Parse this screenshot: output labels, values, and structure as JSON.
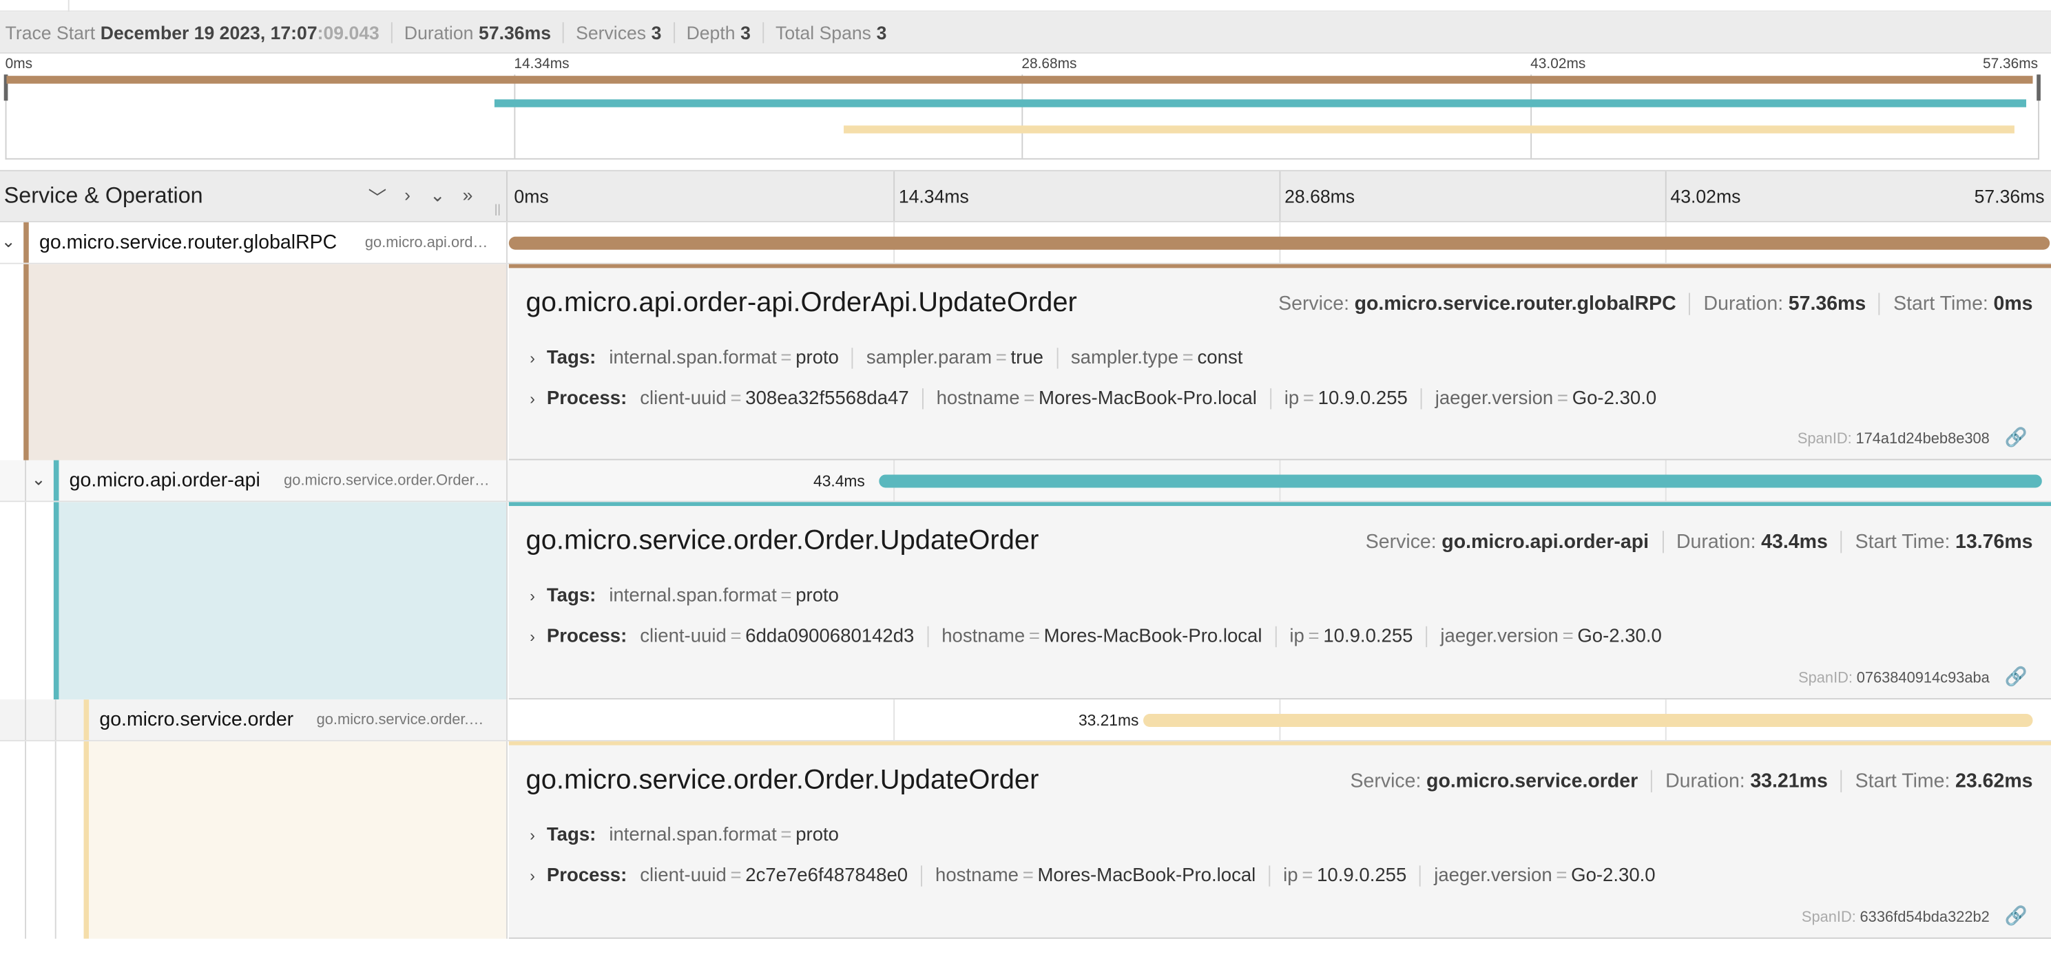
{
  "summary": {
    "trace_start_label": "Trace Start",
    "trace_start_value": "December 19 2023, 17:07",
    "trace_start_ms": ":09.043",
    "duration_label": "Duration",
    "duration_value": "57.36ms",
    "services_label": "Services",
    "services_value": "3",
    "depth_label": "Depth",
    "depth_value": "3",
    "total_spans_label": "Total Spans",
    "total_spans_value": "3"
  },
  "ticks": [
    "0ms",
    "14.34ms",
    "28.68ms",
    "43.02ms",
    "57.36ms"
  ],
  "header": {
    "title": "Service & Operation",
    "controls": [
      "chevron-down-icon",
      "chevron-right-icon",
      "double-chevron-down-icon",
      "double-chevron-right-icon"
    ]
  },
  "colors": {
    "router": "#b58a63",
    "order_api": "#5ab8be",
    "order": "#f5deaa",
    "router_bg": "#f0e8e1",
    "order_api_bg": "#dcedf0",
    "order_bg": "#fbf6ec"
  },
  "spans": [
    {
      "service": "go.micro.service.router.globalRPC",
      "operation": "go.micro.api.order-api.OrderApi.UpdateOrder",
      "operation_short": "go.micro.api.ord…",
      "bar_label": "",
      "start_ms": 0,
      "duration_ms": 57.36,
      "detail": {
        "title": "go.micro.api.order-api.OrderApi.UpdateOrder",
        "service_label": "Service:",
        "service_value": "go.micro.service.router.globalRPC",
        "duration_label": "Duration:",
        "duration_value": "57.36ms",
        "start_label": "Start Time:",
        "start_value": "0ms",
        "tags_label": "Tags:",
        "tags": [
          {
            "k": "internal.span.format",
            "v": "proto"
          },
          {
            "k": "sampler.param",
            "v": "true"
          },
          {
            "k": "sampler.type",
            "v": "const"
          }
        ],
        "process_label": "Process:",
        "process": [
          {
            "k": "client-uuid",
            "v": "308ea32f5568da47"
          },
          {
            "k": "hostname",
            "v": "Mores-MacBook-Pro.local"
          },
          {
            "k": "ip",
            "v": "10.9.0.255"
          },
          {
            "k": "jaeger.version",
            "v": "Go-2.30.0"
          }
        ],
        "spanid_label": "SpanID:",
        "spanid_value": "174a1d24beb8e308"
      }
    },
    {
      "service": "go.micro.api.order-api",
      "operation": "go.micro.service.order.Order.UpdateOrder",
      "operation_short": "go.micro.service.order.Order…",
      "bar_label": "43.4ms",
      "start_ms": 13.76,
      "duration_ms": 43.4,
      "detail": {
        "title": "go.micro.service.order.Order.UpdateOrder",
        "service_label": "Service:",
        "service_value": "go.micro.api.order-api",
        "duration_label": "Duration:",
        "duration_value": "43.4ms",
        "start_label": "Start Time:",
        "start_value": "13.76ms",
        "tags_label": "Tags:",
        "tags": [
          {
            "k": "internal.span.format",
            "v": "proto"
          }
        ],
        "process_label": "Process:",
        "process": [
          {
            "k": "client-uuid",
            "v": "6dda0900680142d3"
          },
          {
            "k": "hostname",
            "v": "Mores-MacBook-Pro.local"
          },
          {
            "k": "ip",
            "v": "10.9.0.255"
          },
          {
            "k": "jaeger.version",
            "v": "Go-2.30.0"
          }
        ],
        "spanid_label": "SpanID:",
        "spanid_value": "0763840914c93aba"
      }
    },
    {
      "service": "go.micro.service.order",
      "operation": "go.micro.service.order.Order.UpdateOrder",
      "operation_short": "go.micro.service.order.…",
      "bar_label": "33.21ms",
      "start_ms": 23.62,
      "duration_ms": 33.21,
      "detail": {
        "title": "go.micro.service.order.Order.UpdateOrder",
        "service_label": "Service:",
        "service_value": "go.micro.service.order",
        "duration_label": "Duration:",
        "duration_value": "33.21ms",
        "start_label": "Start Time:",
        "start_value": "23.62ms",
        "tags_label": "Tags:",
        "tags": [
          {
            "k": "internal.span.format",
            "v": "proto"
          }
        ],
        "process_label": "Process:",
        "process": [
          {
            "k": "client-uuid",
            "v": "2c7e7e6f487848e0"
          },
          {
            "k": "hostname",
            "v": "Mores-MacBook-Pro.local"
          },
          {
            "k": "ip",
            "v": "10.9.0.255"
          },
          {
            "k": "jaeger.version",
            "v": "Go-2.30.0"
          }
        ],
        "spanid_label": "SpanID:",
        "spanid_value": "6336fd54bda322b2"
      }
    }
  ]
}
